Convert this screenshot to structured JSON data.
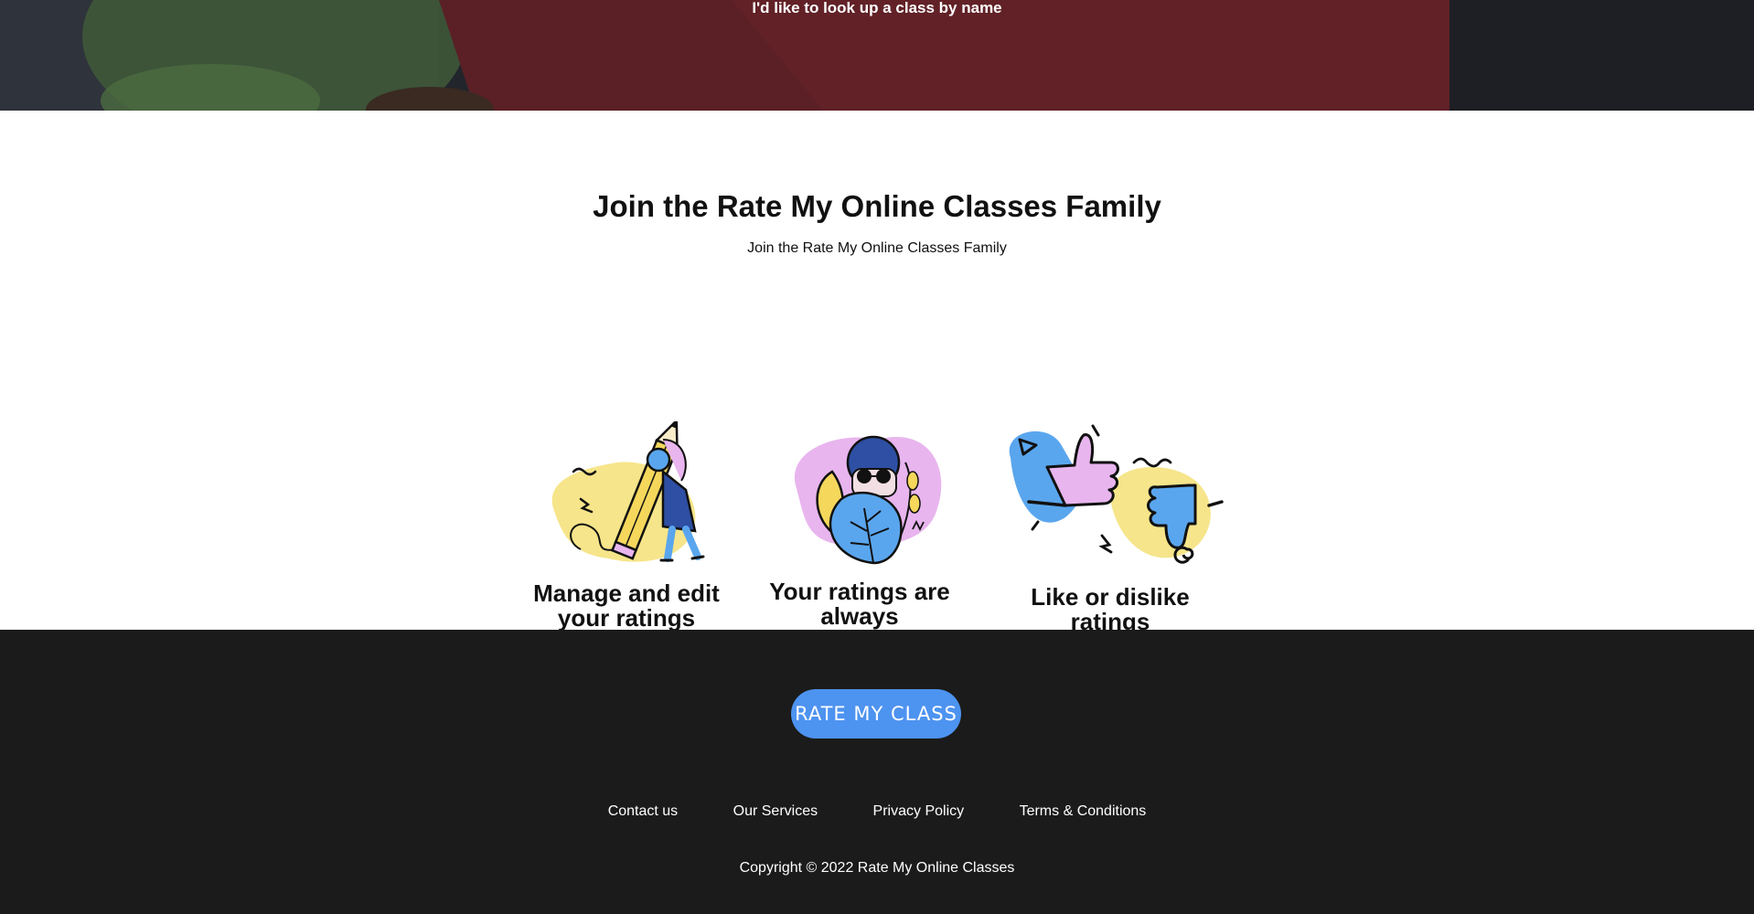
{
  "hero": {
    "text": "I'd like to look up a class by name"
  },
  "join": {
    "title": "Join the Rate My Online Classes Family",
    "subtitle": "Join the Rate My Online Classes Family",
    "features": [
      {
        "icon": "pencil-person-icon",
        "caption": "Manage and edit your ratings"
      },
      {
        "icon": "anonymous-person-icon",
        "caption": "Your ratings are always anonymous"
      },
      {
        "icon": "thumbs-up-down-icon",
        "caption": "Like or dislike ratings"
      }
    ]
  },
  "footer": {
    "cta_label": "RATE MY CLASS",
    "links": [
      "Contact us",
      "Our Services",
      "Privacy Policy",
      "Terms & Conditions"
    ],
    "copyright": "Copyright © 2022 Rate My Online Classes"
  },
  "colors": {
    "footer_bg": "#1b1b1b",
    "cta_blue": "#4d93f0",
    "illustration_yellow": "#f6e58a",
    "illustration_pink": "#e8b5ee",
    "illustration_blue": "#5aa6ee"
  }
}
